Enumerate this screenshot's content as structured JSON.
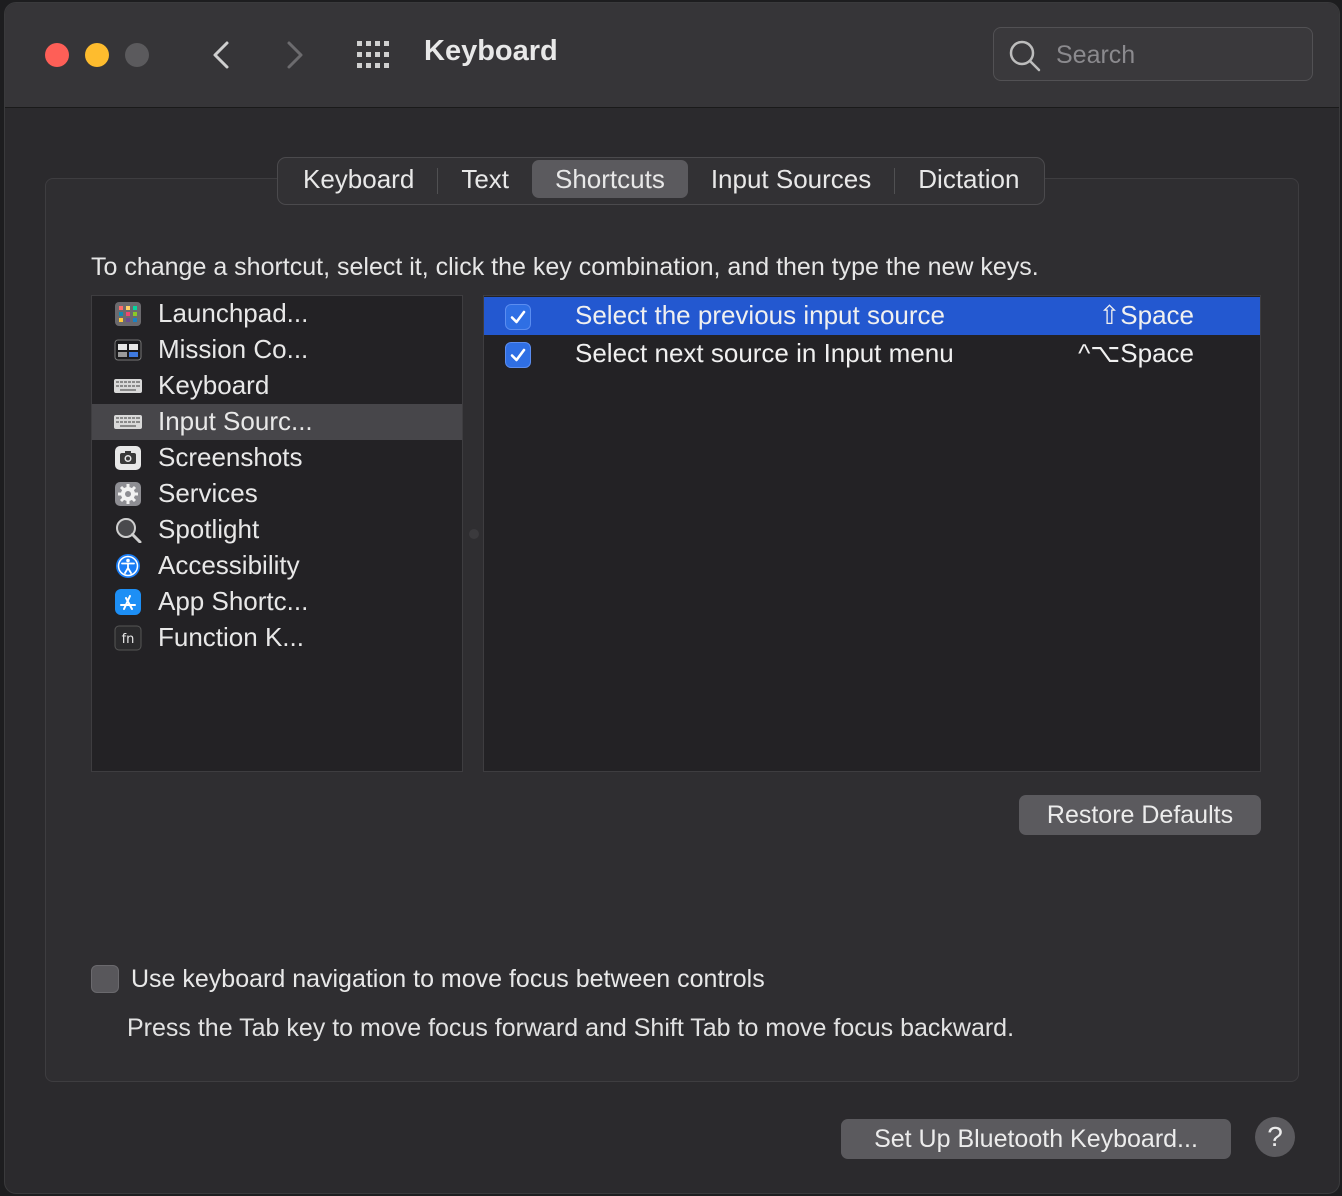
{
  "window": {
    "title": "Keyboard",
    "search_placeholder": "Search"
  },
  "tabs": [
    {
      "label": "Keyboard"
    },
    {
      "label": "Text"
    },
    {
      "label": "Shortcuts",
      "active": true
    },
    {
      "label": "Input Sources"
    },
    {
      "label": "Dictation"
    }
  ],
  "instruction": "To change a shortcut, select it, click the key combination, and then type the new keys.",
  "categories": [
    {
      "label": "Launchpad...",
      "icon": "launchpad-icon"
    },
    {
      "label": "Mission Co...",
      "icon": "mission-control-icon"
    },
    {
      "label": "Keyboard",
      "icon": "keyboard-icon"
    },
    {
      "label": "Input Sourc...",
      "icon": "keyboard-icon",
      "selected": true
    },
    {
      "label": "Screenshots",
      "icon": "screenshot-icon"
    },
    {
      "label": "Services",
      "icon": "gear-icon"
    },
    {
      "label": "Spotlight",
      "icon": "magnifier-icon"
    },
    {
      "label": "Accessibility",
      "icon": "accessibility-icon"
    },
    {
      "label": "App Shortc...",
      "icon": "app-store-icon"
    },
    {
      "label": "Function K...",
      "icon": "fn-key-icon"
    }
  ],
  "shortcuts": [
    {
      "label": "Select the previous input source",
      "keys": "⇧Space",
      "checked": true,
      "selected": true
    },
    {
      "label": "Select next source in Input menu",
      "keys": "^⌥Space",
      "checked": true,
      "selected": false
    }
  ],
  "restore_defaults": "Restore Defaults",
  "keyboard_nav": {
    "label": "Use keyboard navigation to move focus between controls",
    "checked": false,
    "hint": "Press the Tab key to move focus forward and Shift Tab to move focus backward."
  },
  "bluetooth_button": "Set Up Bluetooth Keyboard...",
  "help_button": "?",
  "colors": {
    "accent": "#2358d0",
    "close": "#fe5f57",
    "minimize": "#febc2e"
  }
}
